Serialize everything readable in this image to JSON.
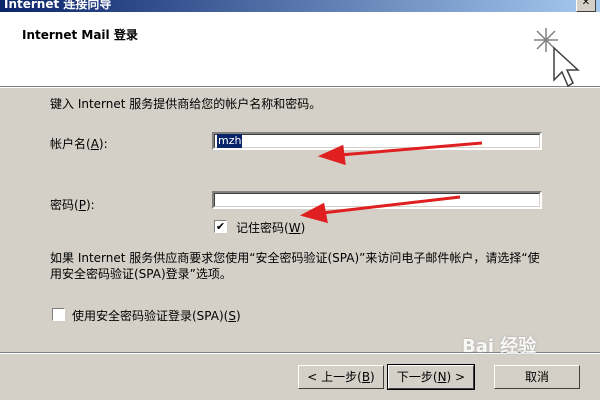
{
  "window": {
    "title": "Internet 连接向导",
    "close_glyph": "✕"
  },
  "header": {
    "title": "Internet Mail 登录",
    "icon": "wizard-sparkle-cursor-icon"
  },
  "instruction": "键入 Internet 服务提供商给您的帐户名称和密码。",
  "account": {
    "label_pre": "帐户名(",
    "label_key": "A",
    "label_post": "):",
    "value": "mzh"
  },
  "password": {
    "label_pre": "密码(",
    "label_key": "P",
    "label_post": "):",
    "value": ""
  },
  "remember": {
    "checked": true,
    "label_pre": "记住密码(",
    "label_key": "W",
    "label_post": ")"
  },
  "note": "如果 Internet 服务供应商要求您使用“安全密码验证(SPA)”来访问电子邮件帐户，请选择“使用安全密码验证(SPA)登录”选项。",
  "spa": {
    "checked": false,
    "label_pre": "使用安全密码验证登录(SPA)(",
    "label_key": "S",
    "label_post": ")"
  },
  "buttons": {
    "back": {
      "pre": "< 上一步(",
      "key": "B",
      "post": ")"
    },
    "next": {
      "pre": "下一步(",
      "key": "N",
      "post": ") >"
    },
    "cancel": "取消"
  },
  "watermark": "Bai 经验",
  "colors": {
    "arrow": "#e02020",
    "selection": "#0a246a",
    "dialog": "#d4d0c8"
  }
}
